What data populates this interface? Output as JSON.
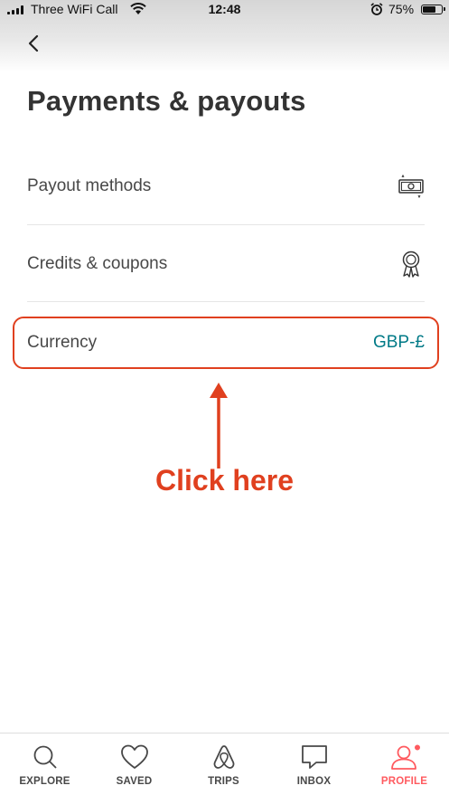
{
  "status_bar": {
    "carrier": "Three WiFi Call",
    "time": "12:48",
    "battery_percent": "75%",
    "battery_level": 0.75,
    "icons": [
      "signal-icon",
      "wifi-icon",
      "alarm-icon",
      "battery-icon"
    ]
  },
  "nav": {
    "back_icon": "chevron-left-icon"
  },
  "page": {
    "title": "Payments & payouts"
  },
  "menu": {
    "items": [
      {
        "label": "Payout methods",
        "icon": "banknote-icon"
      },
      {
        "label": "Credits & coupons",
        "icon": "award-ribbon-icon"
      },
      {
        "label": "Currency",
        "value": "GBP-£"
      }
    ]
  },
  "annotation": {
    "text": "Click here",
    "color": "#e0401f"
  },
  "tabbar": {
    "tabs": [
      {
        "label": "EXPLORE",
        "icon": "search-icon",
        "active": false
      },
      {
        "label": "SAVED",
        "icon": "heart-icon",
        "active": false
      },
      {
        "label": "TRIPS",
        "icon": "airbnb-logo-icon",
        "active": false
      },
      {
        "label": "INBOX",
        "icon": "chat-bubble-icon",
        "active": false
      },
      {
        "label": "PROFILE",
        "icon": "person-icon",
        "active": true
      }
    ]
  },
  "colors": {
    "accent": "#ff5a5f",
    "currency_value": "#007a87",
    "annotation": "#e0401f",
    "text": "#484848"
  }
}
